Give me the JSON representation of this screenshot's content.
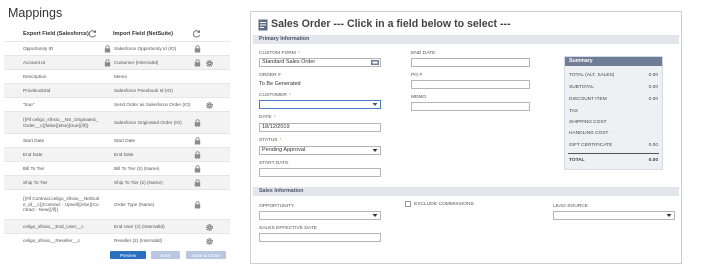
{
  "mappings": {
    "title": "Mappings",
    "header_export": "Export Field (Salesforce)",
    "header_import": "Import Field (NetSuite)",
    "rows": [
      {
        "export": "Opportunity ID",
        "lock": true,
        "import": "Salesforce Opportunity Id (IO)",
        "lock2": true,
        "gear": false,
        "h": 14
      },
      {
        "export": "Account.Id",
        "lock": true,
        "import": "Customer (InternalId)",
        "lock2": true,
        "gear": true,
        "h": 14
      },
      {
        "export": "Description",
        "lock": false,
        "import": "Memo",
        "lock2": false,
        "gear": false,
        "h": 14
      },
      {
        "export": "Pricebook2Id",
        "lock": false,
        "import": "Salesforce Pricebook Id (IO)",
        "lock2": false,
        "gear": false,
        "h": 14
      },
      {
        "export": "\"true\"",
        "lock": false,
        "import": "Send Order as Salesforce Order (IO)",
        "lock2": false,
        "gear": true,
        "h": 14
      },
      {
        "export": "{{#if celigo_sfnsio__NS_Originated_Order__c}}false{{else}}true{{/if}}",
        "lock": false,
        "import": "Salesforce Originated Order (IO)",
        "lock2": true,
        "gear": false,
        "h": 22
      },
      {
        "export": "Start Date",
        "lock": false,
        "import": "Start Date",
        "lock2": true,
        "gear": false,
        "h": 14
      },
      {
        "export": "End Date",
        "lock": false,
        "import": "End Date",
        "lock2": true,
        "gear": false,
        "h": 14
      },
      {
        "export": "Bill To Tier",
        "lock": false,
        "import": "Bill To Tier (2) (Name)",
        "lock2": true,
        "gear": false,
        "h": 14
      },
      {
        "export": "Ship To Tier",
        "lock": false,
        "import": "Ship To Tier (2) (Name)",
        "lock2": true,
        "gear": false,
        "h": 14
      },
      {
        "export": "{{#if Contract.celigo_sfnsio__NetSuite_Id__c}}Contract - Upsell{{else}}Contract - New{{/if}}",
        "lock": false,
        "import": "Order Type (Name)",
        "lock2": true,
        "gear": false,
        "h": 30
      },
      {
        "export": "celigo_sfnsio__End_User__c",
        "lock": false,
        "import": "End User (2) (InternalId)",
        "lock2": false,
        "gear": true,
        "h": 14
      },
      {
        "export": "celigo_sfnsio__Reseller__c",
        "lock": false,
        "import": "Reseller (2) (InternalId)",
        "lock2": false,
        "gear": true,
        "h": 14
      }
    ],
    "buttons": {
      "preview": "Preview",
      "save": "Save",
      "save_close": "Save & Close"
    }
  },
  "sales_order": {
    "title": "Sales Order --- Click in a field below to select ---",
    "primary_header": "Primary Information",
    "custom_form_label": "CUSTOM FORM",
    "custom_form_value": "Standard Sales Order",
    "order_num_label": "ORDER #",
    "order_num_value": "To Be Generated",
    "customer_label": "CUSTOMER",
    "customer_value": "",
    "date_label": "DATE",
    "date_value": "18/12/2019",
    "status_label": "STATUS",
    "status_value": "Pending Approval",
    "start_date_label": "START DATE",
    "start_date_value": "",
    "end_date_label": "END DATE",
    "end_date_value": "",
    "po_label": "PO #",
    "po_value": "",
    "memo_label": "MEMO",
    "memo_value": "",
    "summary": {
      "header": "Summary",
      "rows": [
        {
          "label": "TOTAL (ALT. SALES)",
          "value": "0.00"
        },
        {
          "label": "SUBTOTAL",
          "value": "0.00"
        },
        {
          "label": "DISCOUNT ITEM",
          "value": "0.00"
        },
        {
          "label": "TAX",
          "value": ""
        },
        {
          "label": "SHIPPING COST",
          "value": ""
        },
        {
          "label": "HANDLING COST",
          "value": ""
        },
        {
          "label": "GIFT CERTIFICATE",
          "value": "0.00"
        },
        {
          "label": "TOTAL",
          "value": "0.00"
        }
      ]
    },
    "sales_header": "Sales Information",
    "opportunity_label": "OPPORTUNITY",
    "exclude_commissions_label": "EXCLUDE COMMISSIONS",
    "lead_source_label": "LEAD SOURCE",
    "sales_effective_date_label": "SALES EFFECTIVE DATE"
  },
  "colors": {
    "primary_button": "#2a6fc0",
    "disabled_button": "#b9c7e0",
    "required_marker": "#e67e22",
    "section_header_bg": "#e3e6ec",
    "summary_header_bg": "#6f7d96"
  },
  "icons": [
    "refresh-icon",
    "lock-icon",
    "gear-icon",
    "sales-order-icon",
    "chevron-down-icon",
    "list-picker-icon"
  ]
}
